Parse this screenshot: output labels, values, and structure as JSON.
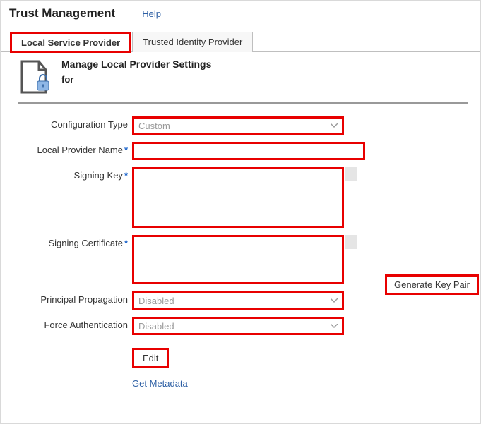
{
  "header": {
    "title": "Trust Management",
    "help": "Help"
  },
  "tabs": {
    "local": "Local Service Provider",
    "trusted": "Trusted Identity Provider"
  },
  "section": {
    "title": "Manage Local Provider Settings",
    "subtitle": "for"
  },
  "form": {
    "config_type": {
      "label": "Configuration Type",
      "value": "Custom"
    },
    "local_provider_name": {
      "label": "Local Provider Name",
      "value": ""
    },
    "signing_key": {
      "label": "Signing Key",
      "value": ""
    },
    "signing_certificate": {
      "label": "Signing Certificate",
      "value": ""
    },
    "principal_propagation": {
      "label": "Principal Propagation",
      "value": "Disabled"
    },
    "force_authentication": {
      "label": "Force Authentication",
      "value": "Disabled"
    }
  },
  "buttons": {
    "generate_key_pair": "Generate Key Pair",
    "edit": "Edit",
    "get_metadata": "Get Metadata"
  }
}
